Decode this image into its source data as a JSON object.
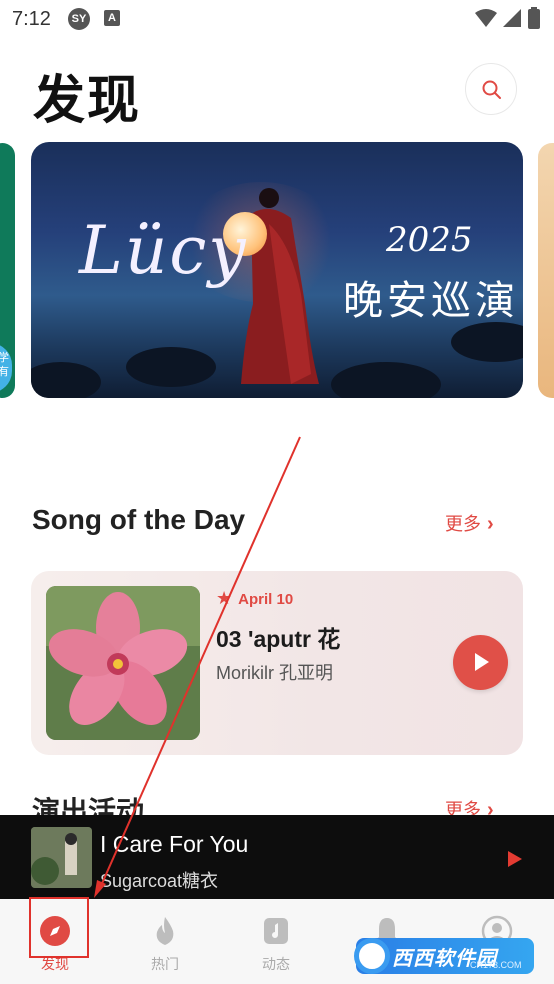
{
  "status_bar": {
    "time": "7:12",
    "app_icon_1": "SY",
    "app_icon_2": "A",
    "icons": [
      "wifi-icon",
      "signal-icon",
      "battery-icon"
    ]
  },
  "header": {
    "title": "发现",
    "search_icon": "search-icon"
  },
  "carousel": {
    "banner_title": "Lücy",
    "banner_year": "2025",
    "banner_event": "晚安巡演",
    "left_peek_badge": "学\n有"
  },
  "song_of_day": {
    "section_title": "Song of the Day",
    "more_label": "更多",
    "date": "April 10",
    "song_title": "03 'aputr 花",
    "artist": "Morikilr 孔亚明"
  },
  "next_section": {
    "section_title": "演出活动",
    "more_label": "更多"
  },
  "mini_player": {
    "title": "I Care For You",
    "artist": "Sugarcoat糖衣"
  },
  "bottom_nav": {
    "items": [
      {
        "label": "发现",
        "icon": "compass-icon",
        "active": true
      },
      {
        "label": "热门",
        "icon": "flame-icon",
        "active": false
      },
      {
        "label": "动态",
        "icon": "music-card-icon",
        "active": false
      },
      {
        "label": "",
        "icon": "bell-icon",
        "active": false
      },
      {
        "label": "",
        "icon": "profile-icon",
        "active": false
      }
    ]
  },
  "watermark": {
    "main": "西西软件园",
    "sub": "CR173.COM"
  },
  "colors": {
    "accent": "#e04a44",
    "mini_player_bg": "#0d0d0d",
    "nav_bg": "#f7f7f7"
  }
}
